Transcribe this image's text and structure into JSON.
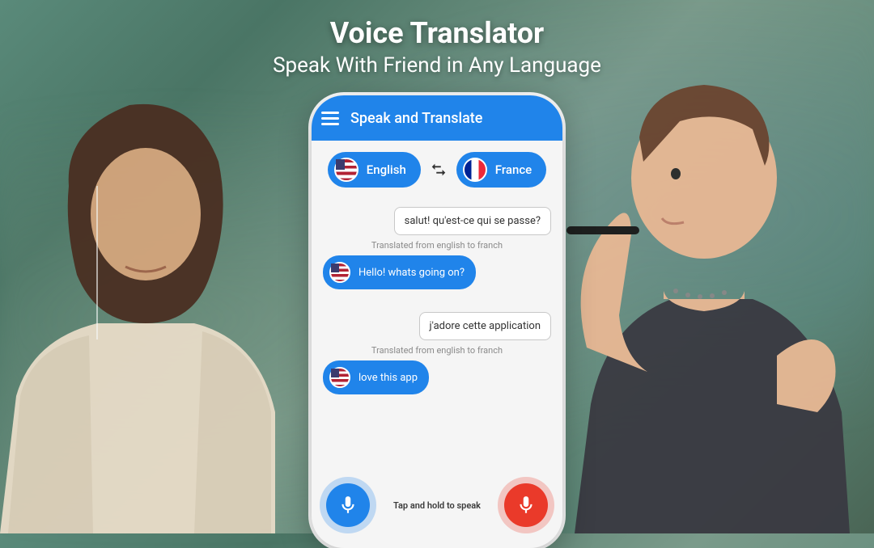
{
  "hero": {
    "title": "Voice Translator",
    "subtitle": "Speak With Friend in Any Language"
  },
  "app": {
    "header_title": "Speak and Translate"
  },
  "languages": {
    "source": {
      "label": "English"
    },
    "target": {
      "label": "France"
    }
  },
  "messages": [
    {
      "type": "out",
      "text": "salut! qu'est-ce qui se passe?"
    },
    {
      "type": "note",
      "text": "Translated from english to franch"
    },
    {
      "type": "in",
      "text": "Hello! whats going on?"
    },
    {
      "type": "out",
      "text": "j'adore cette application"
    },
    {
      "type": "note",
      "text": "Translated from english to franch"
    },
    {
      "type": "in",
      "text": "love this app"
    }
  ],
  "footer": {
    "hint": "Tap and hold to speak"
  }
}
